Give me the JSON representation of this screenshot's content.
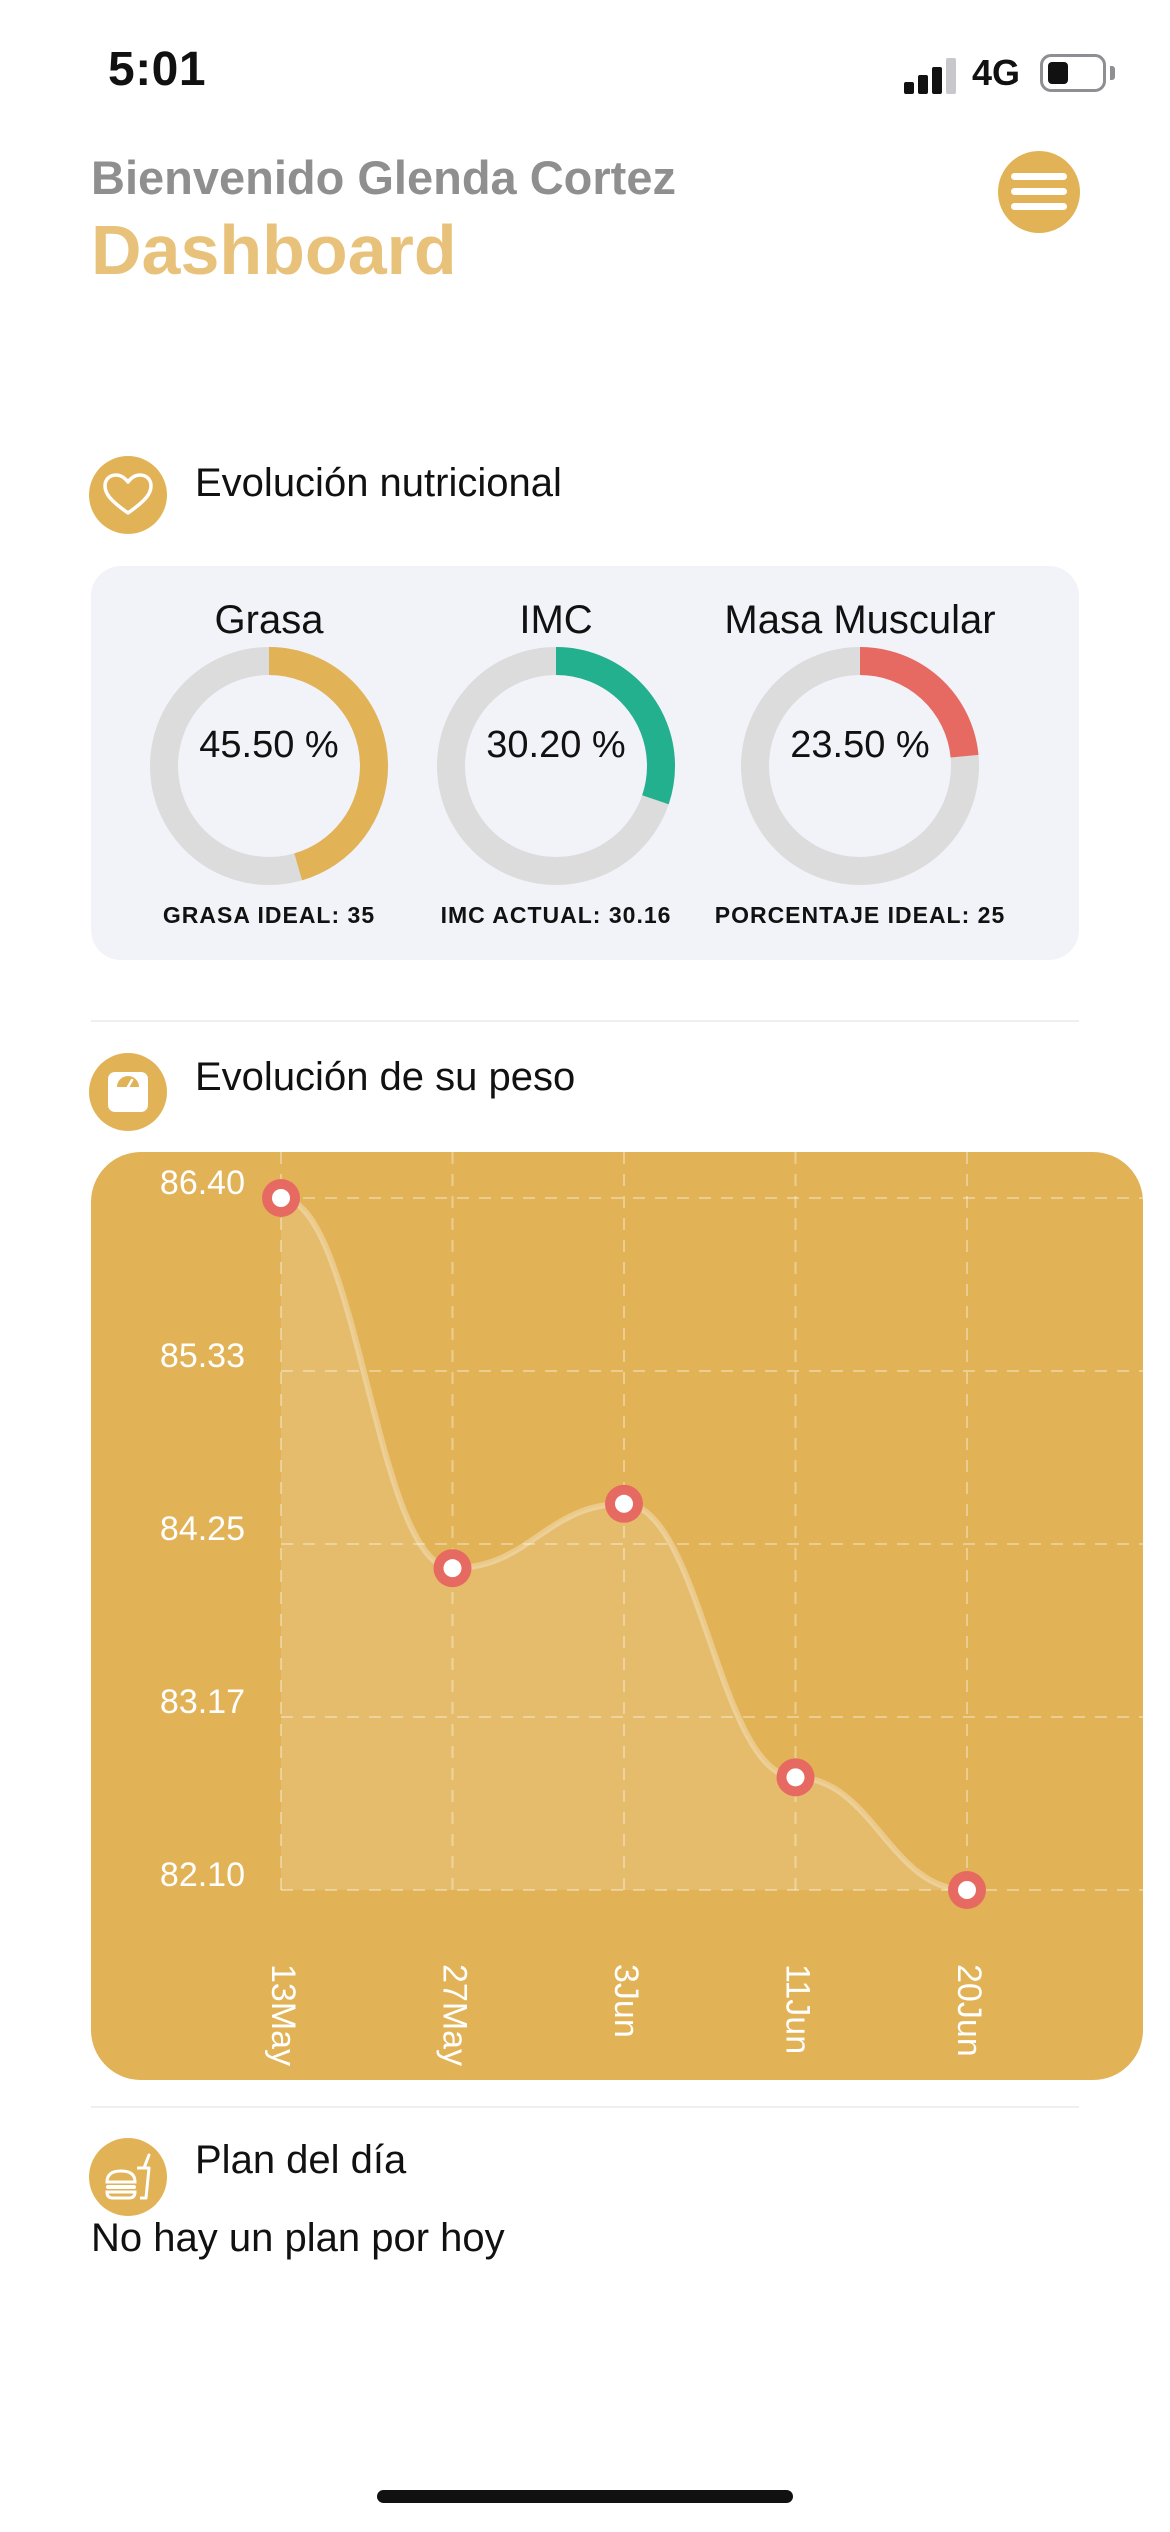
{
  "status_bar": {
    "time": "5:01",
    "network": "4G"
  },
  "header": {
    "welcome": "Bienvenido Glenda Cortez",
    "title": "Dashboard",
    "menu_icon": "hamburger-menu-icon"
  },
  "nutrition": {
    "title": "Evolución nutricional",
    "icon": "heart-icon",
    "metrics": [
      {
        "label": "Grasa",
        "value_text": "45.50 %",
        "value": 45.5,
        "caption": "GRASA IDEAL: 35",
        "color": "#e2b257"
      },
      {
        "label": "IMC",
        "value_text": "30.20 %",
        "value": 30.2,
        "caption": "IMC ACTUAL: 30.16",
        "color": "#23b08f"
      },
      {
        "label": "Masa Muscular",
        "value_text": "23.50 %",
        "value": 23.5,
        "caption": "PORCENTAJE IDEAL: 25",
        "color": "#e76a62"
      }
    ]
  },
  "weight": {
    "title": "Evolución de su peso",
    "icon": "scale-icon"
  },
  "plan": {
    "title": "Plan del día",
    "icon": "food-icon",
    "empty_text": "No hay un plan por hoy"
  },
  "colors": {
    "accent": "#e2b257",
    "title": "#e8c27a",
    "point": "#e76a62"
  },
  "chart_data": {
    "type": "line",
    "title": "",
    "xlabel": "",
    "ylabel": "",
    "categories": [
      "13May",
      "27May",
      "3Jun",
      "11Jun",
      "20Jun"
    ],
    "series": [
      {
        "values": [
          86.4,
          84.1,
          84.5,
          82.8,
          82.1
        ]
      }
    ],
    "yticks": [
      "86.40",
      "85.33",
      "84.25",
      "83.17",
      "82.10"
    ],
    "ylim": [
      82.1,
      86.4
    ],
    "grid": true,
    "area_fill": true,
    "smooth": true
  }
}
